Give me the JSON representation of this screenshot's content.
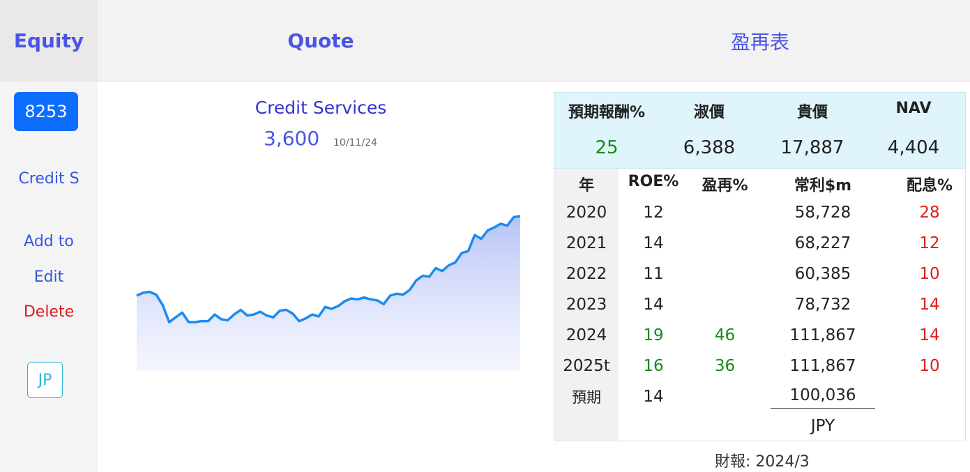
{
  "sidebar": {
    "title": "Equity",
    "ticker": "8253",
    "company_short": "Credit S",
    "add_label": "Add to",
    "edit_label": "Edit",
    "delete_label": "Delete",
    "country": "JP"
  },
  "tabs": {
    "quote": "Quote",
    "income": "盈再表"
  },
  "quote": {
    "company": "Credit Services",
    "price": "3,600",
    "date": "10/11/24"
  },
  "colors": {
    "accent": "#4a55e6",
    "ticker_bg": "#0d6efd",
    "line": "#1a8cf0",
    "green": "#1a8a1a",
    "red": "#e01b1b"
  },
  "chart_data": {
    "type": "area",
    "values": [
      56,
      59,
      60,
      57,
      46,
      28,
      33,
      38,
      28,
      28,
      29,
      29,
      36,
      31,
      30,
      36,
      41,
      35,
      36,
      39,
      35,
      33,
      40,
      41,
      37,
      29,
      32,
      36,
      34,
      44,
      42,
      45,
      50,
      53,
      52,
      54,
      52,
      51,
      47,
      56,
      58,
      57,
      62,
      72,
      77,
      76,
      85,
      82,
      88,
      91,
      101,
      103,
      120,
      116,
      125,
      128,
      132,
      130,
      139,
      140
    ],
    "grid": false
  },
  "summary": {
    "headers": [
      "預期報酬%",
      "淑價",
      "貴價",
      "NAV"
    ],
    "values": [
      "25",
      "6,388",
      "17,887",
      "4,404"
    ]
  },
  "financials": {
    "headers": [
      "年",
      "ROE%",
      "盈再%",
      "常利$m",
      "配息%"
    ],
    "rows": [
      {
        "year": "2020",
        "roe": "12",
        "reinvest": "",
        "profit": "58,728",
        "payout": "28"
      },
      {
        "year": "2021",
        "roe": "14",
        "reinvest": "",
        "profit": "68,227",
        "payout": "12"
      },
      {
        "year": "2022",
        "roe": "11",
        "reinvest": "",
        "profit": "60,385",
        "payout": "10"
      },
      {
        "year": "2023",
        "roe": "14",
        "reinvest": "",
        "profit": "78,732",
        "payout": "14"
      },
      {
        "year": "2024",
        "roe": "19",
        "reinvest": "46",
        "profit": "111,867",
        "payout": "14"
      },
      {
        "year": "2025t",
        "roe": "16",
        "reinvest": "36",
        "profit": "111,867",
        "payout": "10"
      }
    ],
    "expected": {
      "label": "預期",
      "roe": "14",
      "profit": "100,036"
    },
    "currency": "JPY",
    "report": "財報: 2024/3"
  }
}
